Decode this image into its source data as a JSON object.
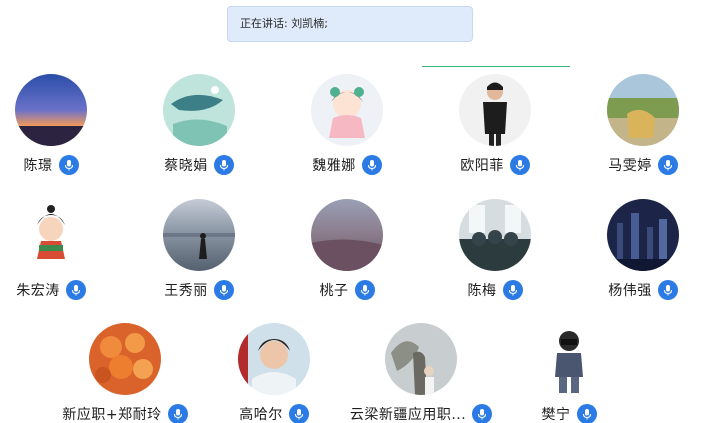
{
  "speaking": {
    "label": "正在讲话: ",
    "name": "刘凯楠;"
  },
  "participants": [
    {
      "name": "陈璟"
    },
    {
      "name": "蔡晓娟"
    },
    {
      "name": "魏雅娜"
    },
    {
      "name": "欧阳菲"
    },
    {
      "name": "马雯婷"
    },
    {
      "name": "朱宏涛"
    },
    {
      "name": "王秀丽"
    },
    {
      "name": "桃子"
    },
    {
      "name": "陈梅"
    },
    {
      "name": "杨伟强"
    },
    {
      "name": "新应职+郑耐玲"
    },
    {
      "name": "高哈尔"
    },
    {
      "name": "云梁新疆应用职..."
    },
    {
      "name": "樊宁"
    }
  ],
  "icons": {
    "mic": "microphone-icon"
  },
  "colors": {
    "accent": "#2c7be5",
    "banner": "#dfeafb",
    "divider": "#38b87a"
  }
}
